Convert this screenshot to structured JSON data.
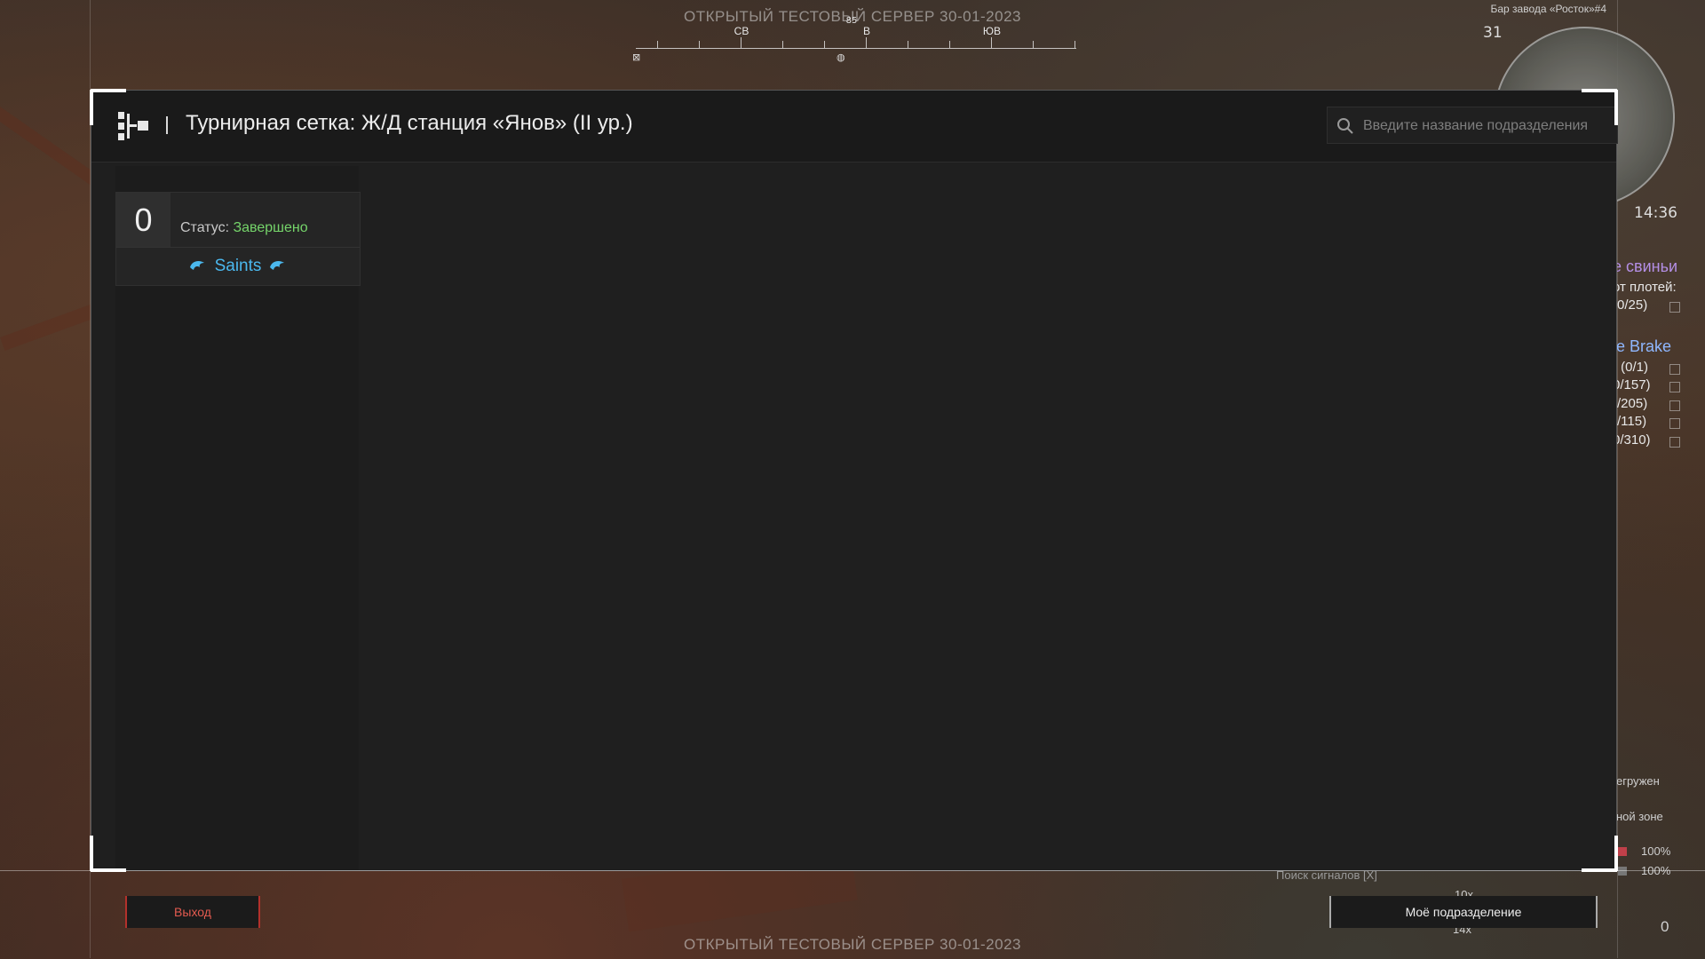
{
  "watermark": "ОТКРЫТЫЙ ТЕСТОВЫЙ СЕРВЕР 30-01-2023",
  "compass": {
    "labels": [
      "СВ",
      "В",
      "ЮВ"
    ],
    "degree": "85"
  },
  "hud": {
    "minimap_title": "Бар завода «Росток»#4",
    "minimap_number": "31",
    "time": "14:36",
    "quest1_title": "е свиньи",
    "quest1_line1": "от плотей:",
    "quest1_line2": "(0/25)",
    "quest2_title": "le Brake",
    "quest2_lines": [
      "r (0/1)",
      "0/157)",
      ")/205)",
      ")/115)",
      "0/310)"
    ],
    "line_overloaded": "егружен",
    "line_zone": "ной зоне",
    "percent1": "100%",
    "percent2": "100%",
    "signal_search": "Поиск сигналов [X]",
    "counter": "0",
    "ammo": "14x",
    "ammo2": "10x"
  },
  "panel": {
    "title": "Турнирная сетка: Ж/Д станция «Янов» (II ур.)",
    "search_placeholder": "Введите название подразделения",
    "search_value": ""
  },
  "match": {
    "score": "0",
    "status_label": "Статус:",
    "status_value": "Завершено",
    "team": "Saints"
  },
  "buttons": {
    "exit": "Выход",
    "my_unit": "Моё подразделение"
  },
  "colors": {
    "status_complete": "#75d46a",
    "team": "#4bb8ee",
    "exit": "#e25a4f"
  }
}
